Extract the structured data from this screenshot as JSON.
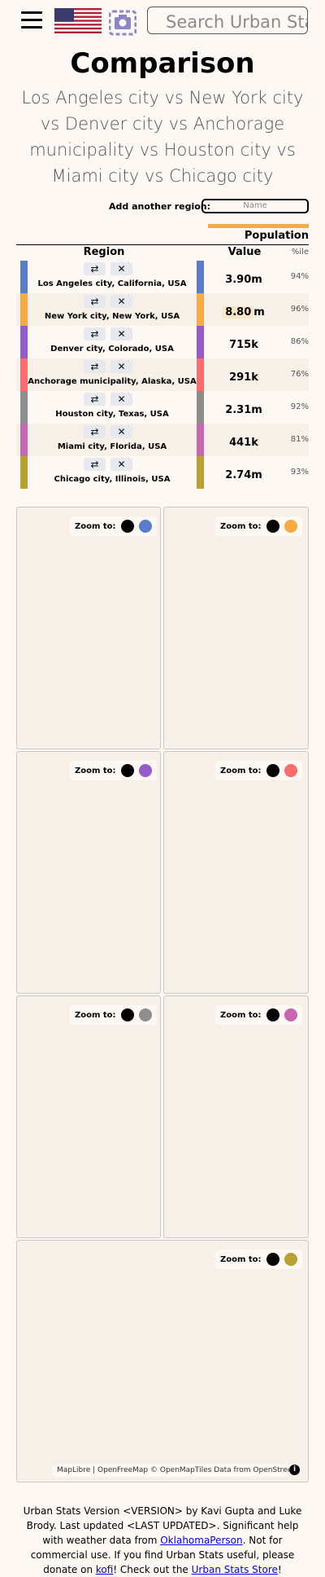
{
  "header": {
    "search_placeholder": "Search Urban Stats"
  },
  "title": "Comparison",
  "subtitle": "Los Angeles city vs New York city vs Denver city vs Anchorage municipality vs Houston city vs Miami city vs Chicago city",
  "add_region": {
    "label": "Add another region:",
    "placeholder": "Name"
  },
  "table": {
    "stat_header": "Population",
    "col_region": "Region",
    "col_value": "Value",
    "col_pct": "%ile",
    "rows": [
      {
        "name": "Los Angeles city, California, USA",
        "value": "3.90",
        "unit": "m",
        "pct": "94%",
        "color": "#5a7dc9"
      },
      {
        "name": "New York city, New York, USA",
        "value": "8.80",
        "unit": "m",
        "pct": "96%",
        "color": "#f7aa41"
      },
      {
        "name": "Denver city, Colorado, USA",
        "value": "715",
        "unit": "k",
        "pct": "86%",
        "color": "#975ac9"
      },
      {
        "name": "Anchorage municipality, Alaska, USA",
        "value": "291",
        "unit": "k",
        "pct": "76%",
        "color": "#f96d6d"
      },
      {
        "name": "Houston city, Texas, USA",
        "value": "2.31",
        "unit": "m",
        "pct": "92%",
        "color": "#8e8e8e"
      },
      {
        "name": "Miami city, Florida, USA",
        "value": "441",
        "unit": "k",
        "pct": "81%",
        "color": "#c767b0"
      },
      {
        "name": "Chicago city, Illinois, USA",
        "value": "2.74",
        "unit": "m",
        "pct": "93%",
        "color": "#b8a032"
      }
    ],
    "button_icons": [
      "replace-icon",
      "close-icon"
    ]
  },
  "maps": {
    "zoom_label": "Zoom to:",
    "attribution": "MapLibre | OpenFreeMap © OpenMapTiles Data from OpenStreetMap"
  },
  "footer": {
    "t1": "Urban Stats Version <VERSION> by Kavi Gupta and Luke Brody. Last updated <LAST UPDATED>. Significant help with weather data from ",
    "link1": "OklahomaPerson",
    "t2": ". Not for commercial use. If you find Urban Stats useful, please donate on ",
    "link2": "kofi",
    "t3": "! Check out the ",
    "link3": "Urban Stats Store",
    "t4": "!"
  }
}
